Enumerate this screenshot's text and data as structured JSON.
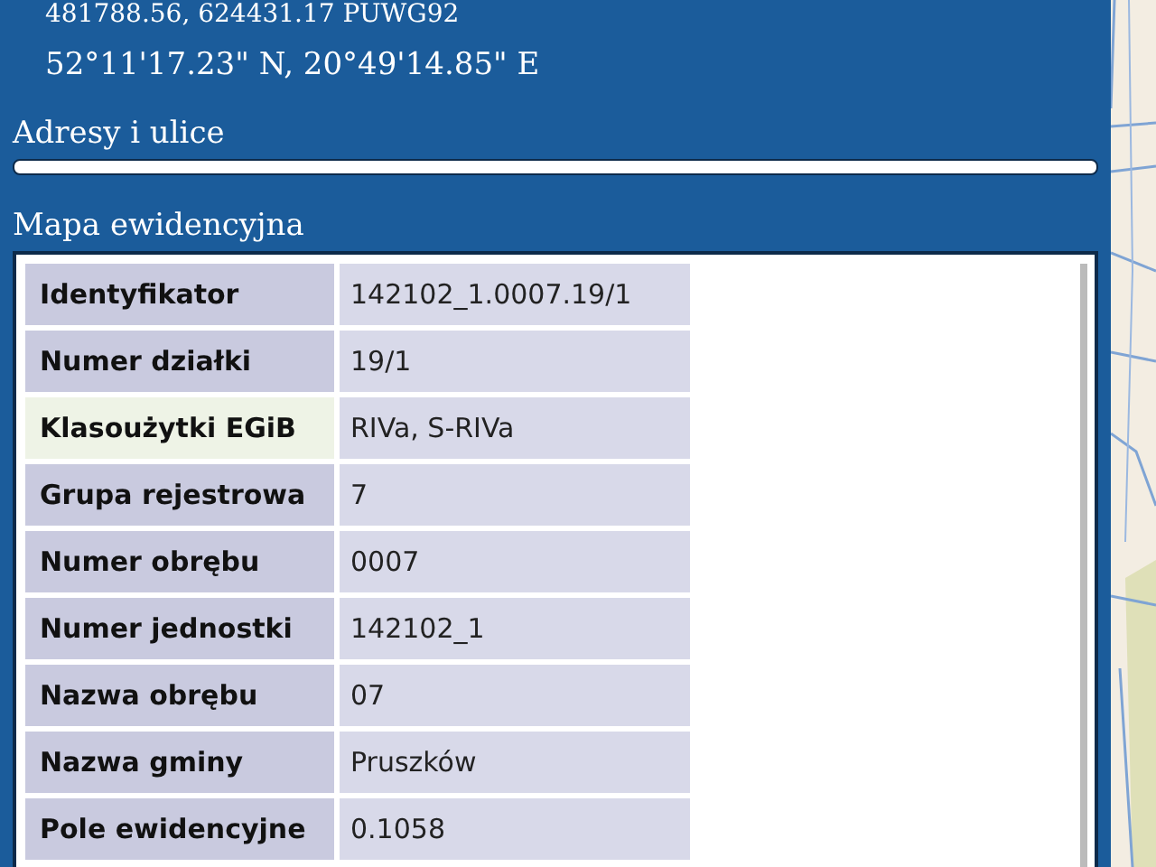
{
  "coordinates": [
    "481788.56, 624431.17 PUWG92",
    "52°11'17.23\" N, 20°49'14.85\" E"
  ],
  "sections": [
    {
      "title": "Adresy i ulice",
      "expanded": false
    },
    {
      "title": "Mapa ewidencyjna",
      "expanded": true
    }
  ],
  "table": {
    "rows": [
      {
        "label": "Identyfikator",
        "value": "142102_1.0007.19/1",
        "highlighted": false
      },
      {
        "label": "Numer działki",
        "value": "19/1",
        "highlighted": false
      },
      {
        "label": "Klasoużytki EGiB",
        "value": "RIVa, S-RIVa",
        "highlighted": true
      },
      {
        "label": "Grupa rejestrowa",
        "value": "7",
        "highlighted": false
      },
      {
        "label": "Numer obrębu",
        "value": "0007",
        "highlighted": false
      },
      {
        "label": "Numer jednostki",
        "value": "142102_1",
        "highlighted": false
      },
      {
        "label": "Nazwa obrębu",
        "value": "07",
        "highlighted": false
      },
      {
        "label": "Nazwa gminy",
        "value": "Pruszków",
        "highlighted": false
      },
      {
        "label": "Pole ewidencyjne",
        "value": "0.1058",
        "highlighted": false
      }
    ]
  }
}
